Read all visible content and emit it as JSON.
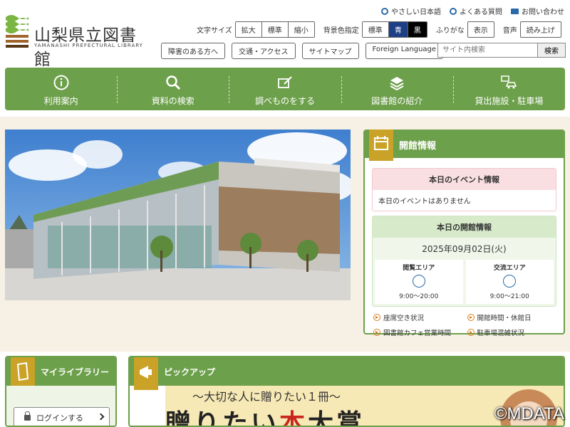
{
  "header": {
    "logo_ja": "山梨県立図書館",
    "logo_en": "YAMANASHI PREFECTURAL LIBRARY",
    "top_links": [
      {
        "label": "やさしい日本語",
        "icon": "globe-icon"
      },
      {
        "label": "よくある質問",
        "icon": "question-icon"
      },
      {
        "label": "お問い合わせ",
        "icon": "mail-icon"
      }
    ],
    "font_size_label": "文字サイズ",
    "font_size_options": [
      "拡大",
      "標準",
      "縮小"
    ],
    "bg_color_label": "背景色指定",
    "bg_color_options": [
      "標準",
      "青",
      "黒"
    ],
    "furigana_label": "ふりがな",
    "furigana_button": "表示",
    "voice_label": "音声",
    "voice_button": "読み上げ",
    "sub_links": [
      "障害のある方へ",
      "交通・アクセス",
      "サイトマップ",
      "Foreign Language"
    ],
    "search_placeholder": "サイト内検索",
    "search_button": "検索"
  },
  "main_nav": [
    {
      "label": "利用案内",
      "icon": "info-icon"
    },
    {
      "label": "資料の検索",
      "icon": "search-icon"
    },
    {
      "label": "調べものをする",
      "icon": "notebook-pen-icon"
    },
    {
      "label": "図書館の紹介",
      "icon": "books-icon"
    },
    {
      "label": "貸出施設・駐車場",
      "icon": "car-computer-icon"
    }
  ],
  "opening_info": {
    "title": "開館情報",
    "event_title": "本日のイベント情報",
    "event_text": "本日のイベントはありません",
    "today_title": "本日の開館情報",
    "date": "2025年09月02日(火)",
    "areas": [
      {
        "name": "閲覧エリア",
        "status": "open",
        "hours": "9:00〜20:00"
      },
      {
        "name": "交流エリア",
        "status": "open",
        "hours": "9:00〜21:00"
      }
    ],
    "links": [
      "座席空き状況",
      "開館時間・休館日",
      "図書館カフェ営業時間",
      "駐車場混雑状況"
    ]
  },
  "my_library": {
    "title": "マイライブラリー",
    "login_button": "ログインする"
  },
  "pickup": {
    "title": "ピックアップ",
    "banner_sub": "〜大切な人に贈りたい１冊〜",
    "banner_title_a": "贈りたい",
    "banner_title_red": "本",
    "banner_title_b": "大賞"
  },
  "watermark": "©MDATA",
  "colors": {
    "green": "#6da04b",
    "gold": "#c9a227",
    "blue": "#1c3f86",
    "pink": "#f9dfe2"
  }
}
